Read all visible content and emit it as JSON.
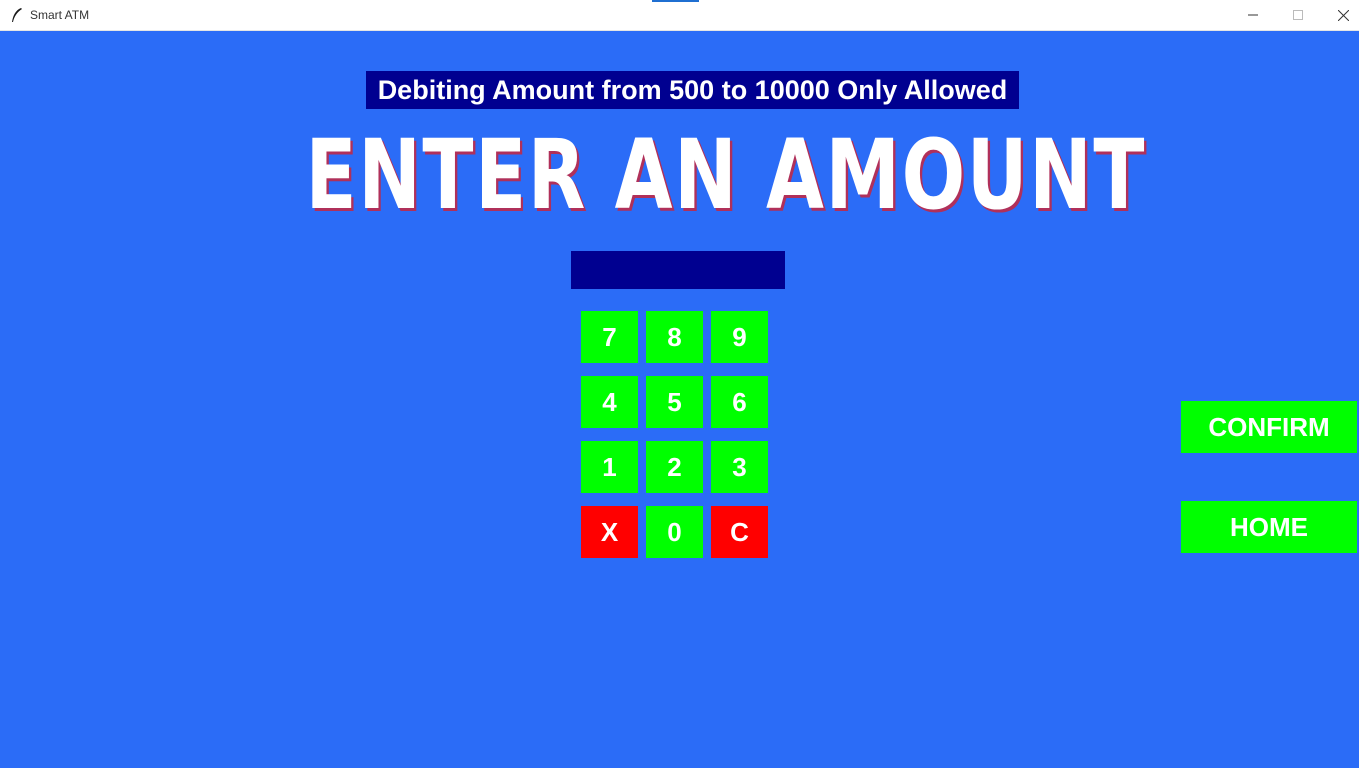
{
  "window": {
    "title": "Smart ATM",
    "icon": "feather-icon",
    "controls": [
      "minimize-icon",
      "maximize-icon",
      "close-icon"
    ]
  },
  "banner": {
    "text": "Debiting Amount from 500 to 10000 Only Allowed"
  },
  "headline": {
    "text": "ENTER AN AMOUNT"
  },
  "amount_input": {
    "value": "",
    "placeholder": ""
  },
  "keypad": {
    "rows": [
      [
        "7",
        "8",
        "9"
      ],
      [
        "4",
        "5",
        "6"
      ],
      [
        "1",
        "2",
        "3"
      ],
      [
        "X",
        "0",
        "C"
      ]
    ]
  },
  "actions": {
    "confirm_label": "CONFIRM",
    "home_label": "HOME"
  },
  "colors": {
    "background": "#2b6cf7",
    "panel": "#000090",
    "key_green": "#00ff00",
    "key_red": "#ff0000",
    "headline_shadow": "#b0305a"
  }
}
